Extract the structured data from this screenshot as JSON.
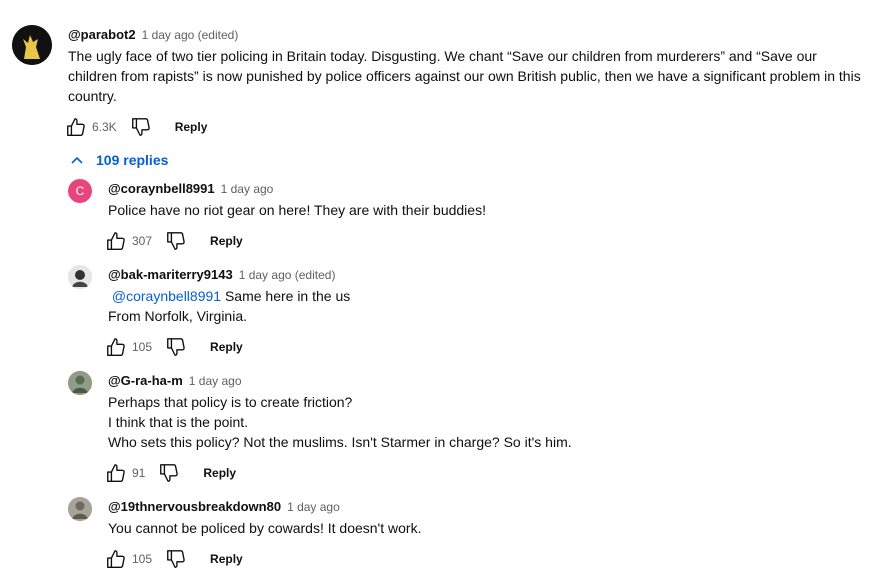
{
  "top_comment": {
    "handle": "@parabot2",
    "meta": "1 day ago (edited)",
    "lines": [
      "The ugly face of two tier policing in Britain today. Disgusting. We chant “Save our children from murderers” and “Save our",
      "children from rapists” is now punished by police officers against our own British public, then we have a significant problem in this",
      "country."
    ],
    "likes": "6.3K",
    "reply_label": "Reply"
  },
  "replies_toggle": {
    "label": "109 replies"
  },
  "replies": [
    {
      "handle": "@coraynbell8991",
      "meta": "1 day ago",
      "avatar_letter": "C",
      "lines": [
        "Police have no riot gear on here!  They are with their buddies!"
      ],
      "likes": "307",
      "reply_label": "Reply"
    },
    {
      "handle": "@bak-mariterry9143",
      "meta": "1 day ago (edited)",
      "mention": "@coraynbell8991",
      "first_line_rest": " Same here in the us",
      "lines": [
        "From Norfolk, Virginia."
      ],
      "likes": "105",
      "reply_label": "Reply"
    },
    {
      "handle": "@G-ra-ha-m",
      "meta": "1 day ago",
      "lines": [
        "Perhaps that policy is to create friction?",
        "I think that is the point.",
        "Who sets this policy? Not the muslims. Isn't Starmer in charge? So it's him."
      ],
      "likes": "91",
      "reply_label": "Reply"
    },
    {
      "handle": "@19thnervousbreakdown80",
      "meta": "1 day ago",
      "lines": [
        "You cannot be policed by cowards! It doesn't work."
      ],
      "likes": "105",
      "reply_label": "Reply"
    }
  ],
  "colors": {
    "mention": "#065fd4",
    "avatar_c": "#e8457b",
    "meta_text": "#606060"
  },
  "icons": {
    "like": "thumbs-up-icon",
    "dislike": "thumbs-down-icon",
    "collapse": "chevron-up-icon"
  }
}
